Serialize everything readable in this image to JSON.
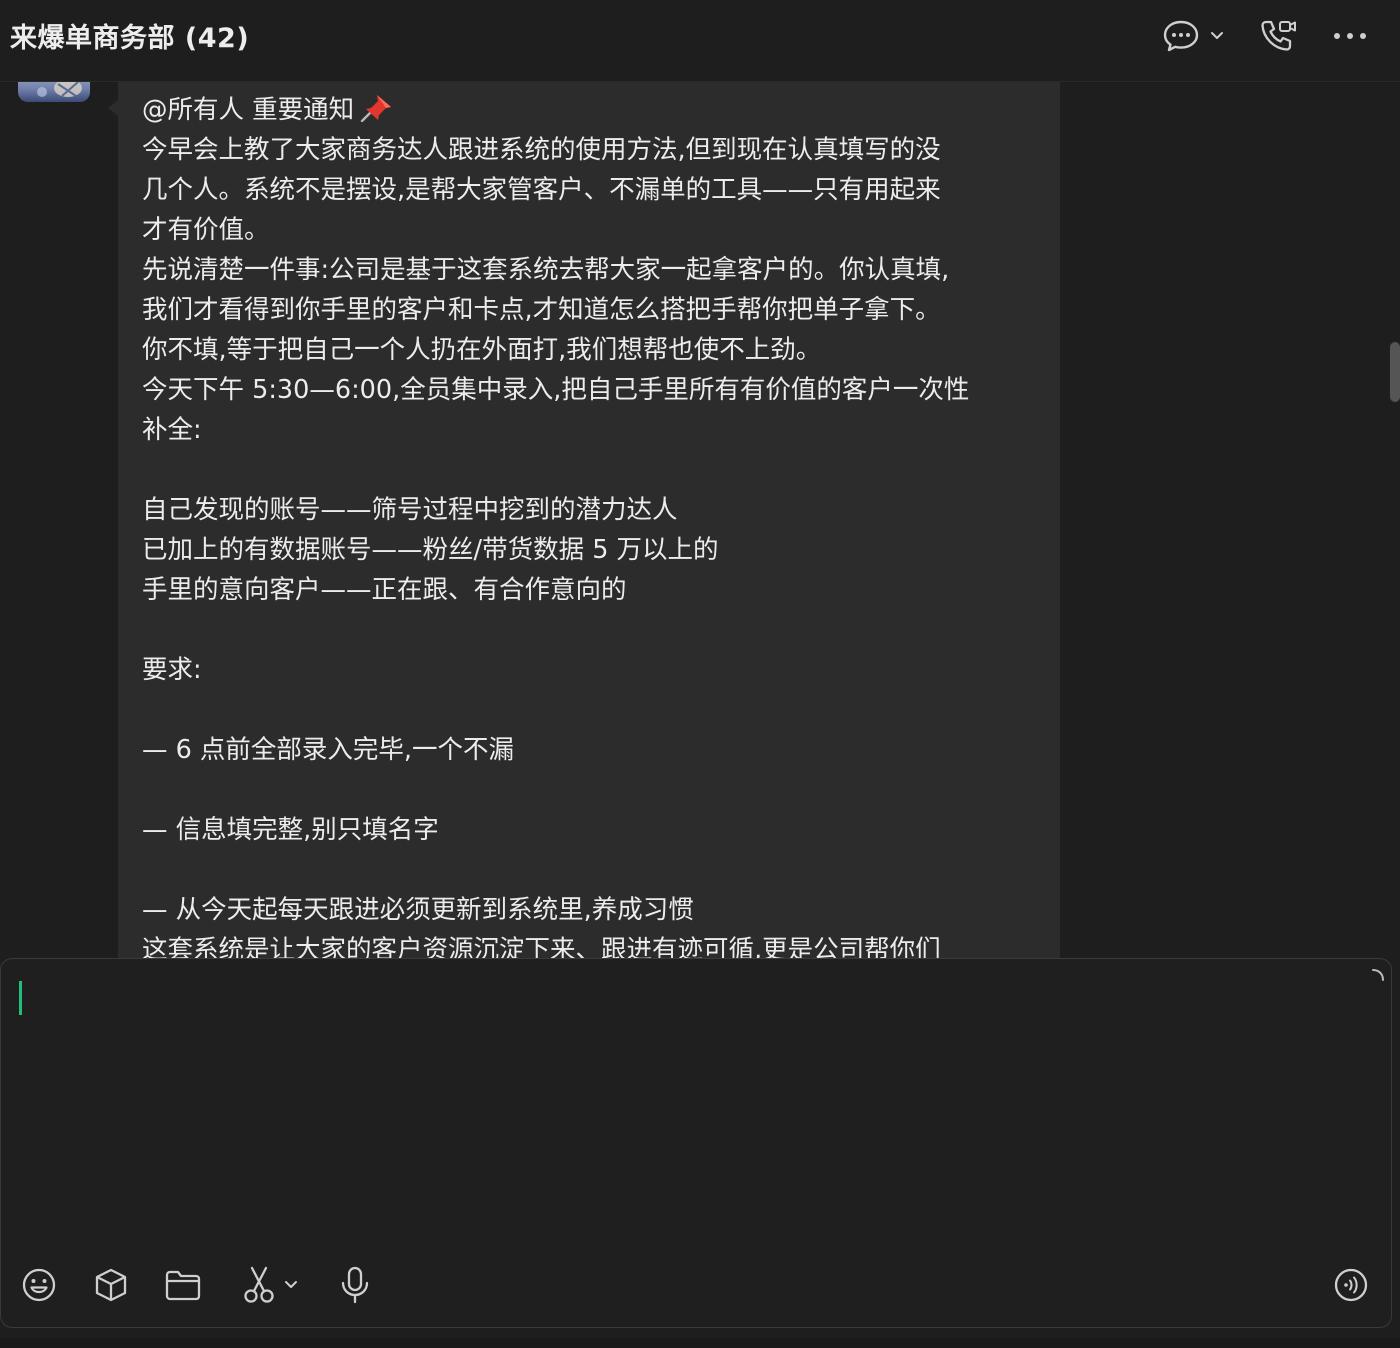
{
  "header": {
    "title": "来爆单商务部 (42)",
    "icons": [
      "chat-bubble-icon",
      "chevron-down-icon",
      "video-call-icon",
      "more-icon"
    ]
  },
  "message": {
    "lines": [
      "@所有人 重要通知",
      "今早会上教了大家商务达人跟进系统的使用方法,但到现在认真填写的没",
      "几个人。系统不是摆设,是帮大家管客户、不漏单的工具——只有用起来",
      "才有价值。",
      "先说清楚一件事:公司是基于这套系统去帮大家一起拿客户的。你认真填,",
      "我们才看得到你手里的客户和卡点,才知道怎么搭把手帮你把单子拿下。",
      "你不填,等于把自己一个人扔在外面打,我们想帮也使不上劲。",
      "今天下午 5:30—6:00,全员集中录入,把自己手里所有有价值的客户一次性",
      "补全:",
      "",
      "自己发现的账号——筛号过程中挖到的潜力达人",
      "已加上的有数据账号——粉丝/带货数据 5 万以上的",
      "手里的意向客户——正在跟、有合作意向的",
      "",
      "要求:",
      "",
      "— 6 点前全部录入完毕,一个不漏",
      "",
      "— 信息填完整,别只填名字",
      "",
      "— 从今天起每天跟进必须更新到系统里,养成习惯",
      "这套系统是让大家的客户资源沉淀下来、跟进有迹可循,更是公司帮你们"
    ],
    "title_emoji": "pushpin-icon"
  },
  "composer": {
    "input_value": "",
    "tools": [
      "emoji-icon",
      "cube-icon",
      "folder-icon",
      "scissors-icon",
      "microphone-icon",
      "voice-to-text-icon"
    ]
  },
  "colors": {
    "background": "#1e1e1e",
    "bubble": "#2c2c2c",
    "caret": "#1fbf7a",
    "text": "#ececec"
  }
}
